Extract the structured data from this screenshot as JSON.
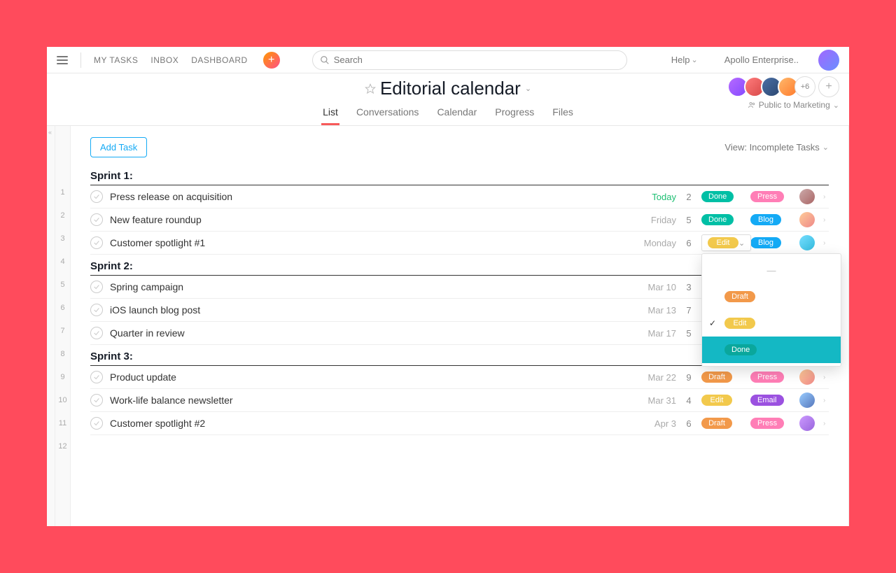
{
  "topbar": {
    "nav_my_tasks": "MY TASKS",
    "nav_inbox": "INBOX",
    "nav_dashboard": "DASHBOARD",
    "search_placeholder": "Search",
    "help_label": "Help",
    "org_label": "Apollo Enterprise.."
  },
  "header": {
    "title": "Editorial calendar",
    "tabs": {
      "list": "List",
      "conversations": "Conversations",
      "calendar": "Calendar",
      "progress": "Progress",
      "files": "Files"
    },
    "members_more": "+6",
    "visibility": "Public to Marketing"
  },
  "toolbar": {
    "add_task": "Add Task",
    "view_filter": "View: Incomplete Tasks"
  },
  "dropdown": {
    "dash": "—",
    "draft": "Draft",
    "edit": "Edit",
    "done": "Done"
  },
  "sections": [
    {
      "title": "Sprint 1:",
      "rows": [
        {
          "num": "1"
        },
        {
          "num": "2",
          "title": "Press release on acquisition",
          "due": "Today",
          "due_today": true,
          "count": "2",
          "status": "Done",
          "status_cls": "pill-done",
          "type": "Press",
          "type_cls": "pill-press",
          "av": "c0"
        },
        {
          "num": "3",
          "title": "New feature roundup",
          "due": "Friday",
          "count": "5",
          "status": "Done",
          "status_cls": "pill-done",
          "type": "Blog",
          "type_cls": "pill-blog",
          "av": "c1"
        },
        {
          "num": "4",
          "title": "Customer spotlight #1",
          "due": "Monday",
          "count": "6",
          "status": "Edit",
          "status_cls": "pill-edit",
          "status_dropdown": true,
          "type": "Blog",
          "type_cls": "pill-blog",
          "av": "c2"
        }
      ]
    },
    {
      "title": "Sprint 2:",
      "rows": [
        {
          "num": "5"
        },
        {
          "num": "6",
          "title": "Spring campaign",
          "due": "Mar 10",
          "count": "3"
        },
        {
          "num": "7",
          "title": "iOS launch blog post",
          "due": "Mar 13",
          "count": "7"
        },
        {
          "num": "8",
          "title": "Quarter in review",
          "due": "Mar 17",
          "count": "5"
        }
      ]
    },
    {
      "title": "Sprint 3:",
      "rows": [
        {
          "num": "9"
        },
        {
          "num": "10",
          "title": "Product update",
          "due": "Mar 22",
          "count": "9",
          "status": "Draft",
          "status_cls": "pill-draft",
          "type": "Press",
          "type_cls": "pill-press",
          "av": "c1"
        },
        {
          "num": "11",
          "title": "Work-life balance newsletter",
          "due": "Mar 31",
          "count": "4",
          "status": "Edit",
          "status_cls": "pill-edit",
          "type": "Email",
          "type_cls": "pill-email",
          "av": "c3"
        },
        {
          "num": "12",
          "title": "Customer spotlight #2",
          "due": "Apr 3",
          "count": "6",
          "status": "Draft",
          "status_cls": "pill-draft",
          "type": "Press",
          "type_cls": "pill-press",
          "av": "c4"
        }
      ]
    }
  ]
}
